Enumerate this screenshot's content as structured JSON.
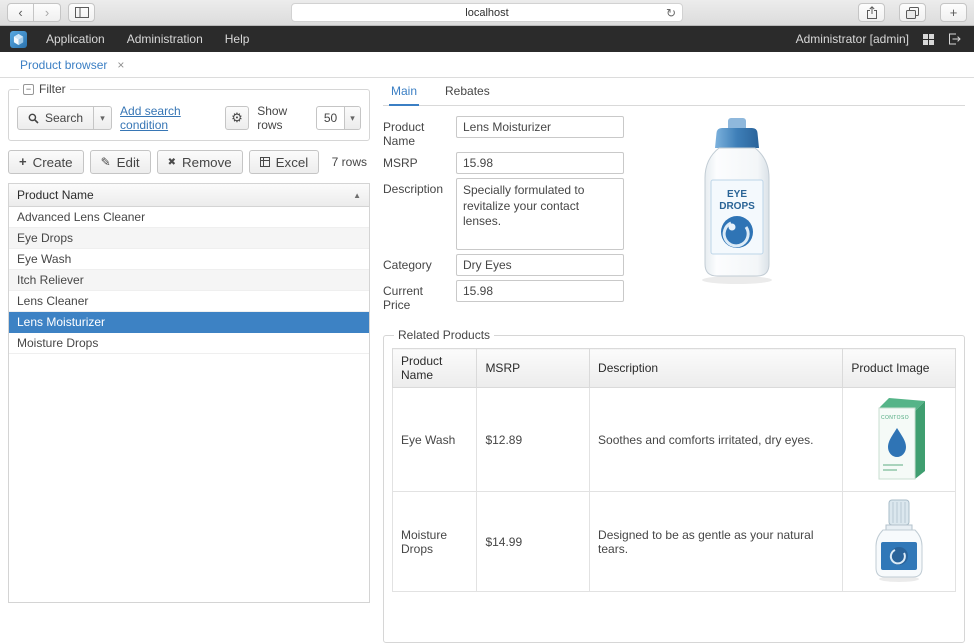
{
  "browser": {
    "url": "localhost"
  },
  "menubar": {
    "items": [
      "Application",
      "Administration",
      "Help"
    ],
    "user_label": "Administrator [admin]"
  },
  "workspace_tab": {
    "label": "Product browser",
    "close_glyph": "×"
  },
  "filter": {
    "legend": "Filter",
    "search_label": "Search",
    "add_condition_link": "Add search condition",
    "show_rows_label": "Show rows",
    "rows_per_page": "50"
  },
  "actions": {
    "create_label": "Create",
    "edit_label": "Edit",
    "remove_label": "Remove",
    "excel_label": "Excel",
    "rows_count": "7 rows"
  },
  "products": {
    "column_header": "Product Name",
    "rows": [
      "Advanced Lens Cleaner",
      "Eye Drops",
      "Eye Wash",
      "Itch Reliever",
      "Lens Cleaner",
      "Lens Moisturizer",
      "Moisture Drops"
    ],
    "selected": "Lens Moisturizer"
  },
  "detail": {
    "tabs": [
      "Main",
      "Rebates"
    ],
    "form": {
      "product_name_label": "Product Name",
      "product_name_value": "Lens Moisturizer",
      "msrp_label": "MSRP",
      "msrp_value": "15.98",
      "description_label": "Description",
      "description_value": "Specially formulated to revitalize your contact lenses.",
      "category_label": "Category",
      "category_value": "Dry Eyes",
      "current_price_label": "Current Price",
      "current_price_value": "15.98"
    },
    "bottle_label_line1": "EYE",
    "bottle_label_line2": "DROPS",
    "box_brand": "CONTOSO",
    "related": {
      "legend": "Related Products",
      "columns": [
        "Product Name",
        "MSRP",
        "Description",
        "Product Image"
      ],
      "rows": [
        {
          "name": "Eye Wash",
          "msrp": "$12.89",
          "description": "Soothes and comforts irritated, dry eyes.",
          "image": "eye-wash-box"
        },
        {
          "name": "Moisture Drops",
          "msrp": "$14.99",
          "description": "Designed to be as gentle as your natural tears.",
          "image": "moisture-drops-bottle"
        }
      ]
    }
  },
  "colors": {
    "accent_blue": "#3b7fc4",
    "selected_row": "#3d82c4",
    "menubar_bg": "#2b2b2b"
  }
}
